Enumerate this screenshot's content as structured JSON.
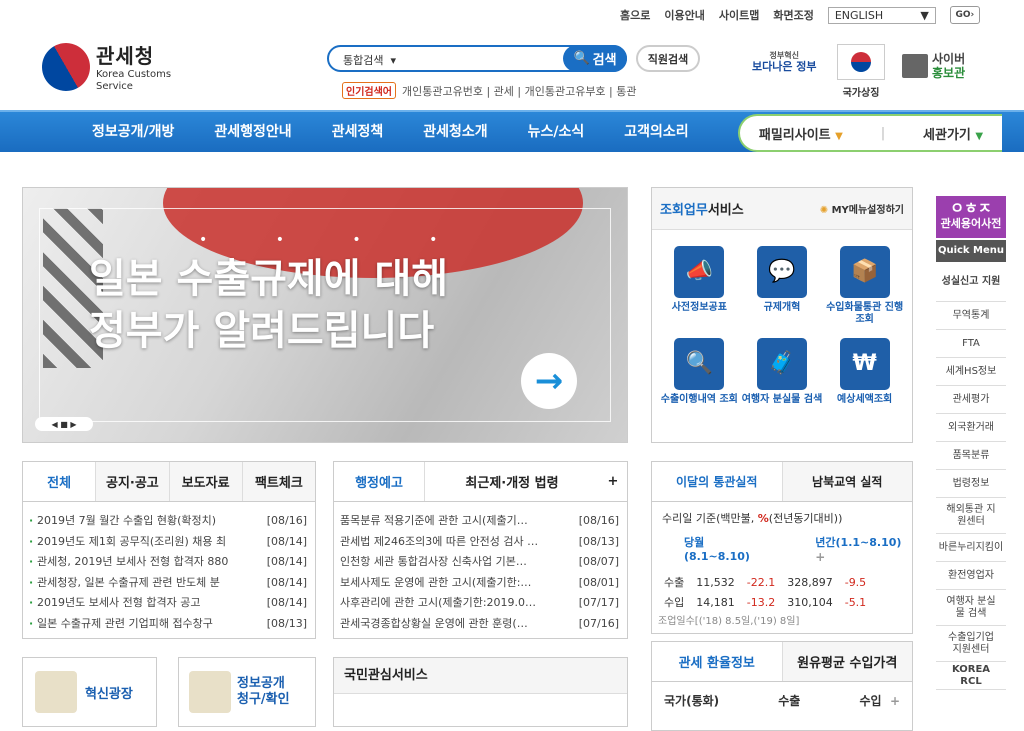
{
  "util": {
    "home": "홈으로",
    "guide": "이용안내",
    "sitemap": "사이트맵",
    "screen": "화면조정",
    "lang": "ENGLISH",
    "go": "GO"
  },
  "logo": {
    "ko": "관세청",
    "en1": "Korea Customs",
    "en2": "Service"
  },
  "search": {
    "select": "통합검색",
    "button": "검색",
    "staff": "직원검색",
    "popular_tag": "인기검색어",
    "popular": "개인통관고유번호 | 관세 | 개인통관고유부호 | 통관"
  },
  "gov": {
    "line1": "정부혁신",
    "line2": "보다나은 정부"
  },
  "symbol": {
    "label": "국가상징"
  },
  "pr": {
    "line1": "사이버",
    "line2": "홍보관"
  },
  "nav": {
    "items": [
      "정보공개/개방",
      "관세행정안내",
      "관세정책",
      "관세청소개",
      "뉴스/소식",
      "고객의소리"
    ],
    "family": "패밀리사이트",
    "visit": "세관가기"
  },
  "banner": {
    "dots": "• • • •",
    "line1": "일본 수출규제에 대해",
    "line2": "정부가 알려드립니다",
    "arrow": "→",
    "ctrl": "◀ ■ ▶"
  },
  "service": {
    "title_a": "조회업무",
    "title_b": "서비스",
    "my": "MY메뉴설정하기",
    "items": [
      {
        "label": "사전정보공표",
        "icon": "📣"
      },
      {
        "label": "규제개혁",
        "icon": "💬"
      },
      {
        "label": "수입화물통관 진행조회",
        "icon": "📦"
      },
      {
        "label": "수출이행내역 조회",
        "icon": "🔍"
      },
      {
        "label": "여행자 분실물 검색",
        "icon": "🧳"
      },
      {
        "label": "예상세액조회",
        "icon": "₩"
      }
    ]
  },
  "quick": {
    "dict1": "ㅇㅎㅈ",
    "dict2": "관세용어사전",
    "title": "Quick Menu",
    "items": [
      "성실신고 지원",
      "무역통계",
      "FTA",
      "세계HS정보",
      "관세평가",
      "외국환거래",
      "품목분류",
      "법령정보",
      "해외통관 지원센터",
      "바른누리지킴이",
      "환전영업자",
      "여행자 분실물 검색",
      "수출입기업 지원센터",
      "KOREA RCL"
    ]
  },
  "news": {
    "tabs": [
      "전체",
      "공지·공고",
      "보도자료",
      "팩트체크"
    ],
    "rows": [
      {
        "t": "2019년 7월 월간 수출입 현황(확정치)",
        "d": "[08/16]"
      },
      {
        "t": "2019년도 제1회 공무직(조리원) 채용 최",
        "d": "[08/14]"
      },
      {
        "t": "관세청, 2019년 보세사 전형 합격자 880",
        "d": "[08/14]"
      },
      {
        "t": "관세청장, 일본 수출규제 관련 반도체 분",
        "d": "[08/14]"
      },
      {
        "t": "2019년도 보세사 전형 합격자 공고",
        "d": "[08/14]"
      },
      {
        "t": "일본 수출규제 관련 기업피해 접수창구",
        "d": "[08/13]"
      }
    ]
  },
  "notice": {
    "tabs": [
      "행정예고",
      "최근제·개정 법령"
    ],
    "plus": "+",
    "rows": [
      {
        "t": "품목분류 적용기준에 관한 고시(제출기…",
        "d": "[08/16]"
      },
      {
        "t": "관세법 제246조의3에 따른 안전성 검사 …",
        "d": "[08/13]"
      },
      {
        "t": "인천항 세관 통합검사장 신축사업 기본…",
        "d": "[08/07]"
      },
      {
        "t": "보세사제도 운영에 관한 고시(제출기한:…",
        "d": "[08/01]"
      },
      {
        "t": "사후관리에 관한 고시(제출기한:2019.0…",
        "d": "[07/17]"
      },
      {
        "t": "관세국경종합상황실 운영에 관한 훈령(…",
        "d": "[07/16]"
      }
    ]
  },
  "stats": {
    "tabs": [
      "이달의 통관실적",
      "남북교역 실적"
    ],
    "basis": "수리일 기준(백만불,",
    "basis_pct": "%",
    "basis_end": "(전년동기대비))",
    "p1": "당월(8.1~8.10)",
    "p2": "년간(1.1~8.10)",
    "plus": "+",
    "rows": [
      {
        "k": "수출",
        "a": "11,532",
        "b": "-22.1",
        "c": "328,897",
        "e": "-9.5"
      },
      {
        "k": "수입",
        "a": "14,181",
        "b": "-13.2",
        "c": "310,104",
        "e": "-5.1"
      }
    ],
    "foot": "조업일수[('18) 8.5일,('19) 8일]"
  },
  "bottom": {
    "innovation": "혁신광장",
    "info1": "정보공개",
    "info2": "청구/확인",
    "interest": "국민관심서비스"
  },
  "rate": {
    "tabs": [
      "관세 환율정보",
      "원유평균 수입가격"
    ],
    "cols": [
      "국가(통화)",
      "수출",
      "수입"
    ],
    "plus": "+"
  }
}
